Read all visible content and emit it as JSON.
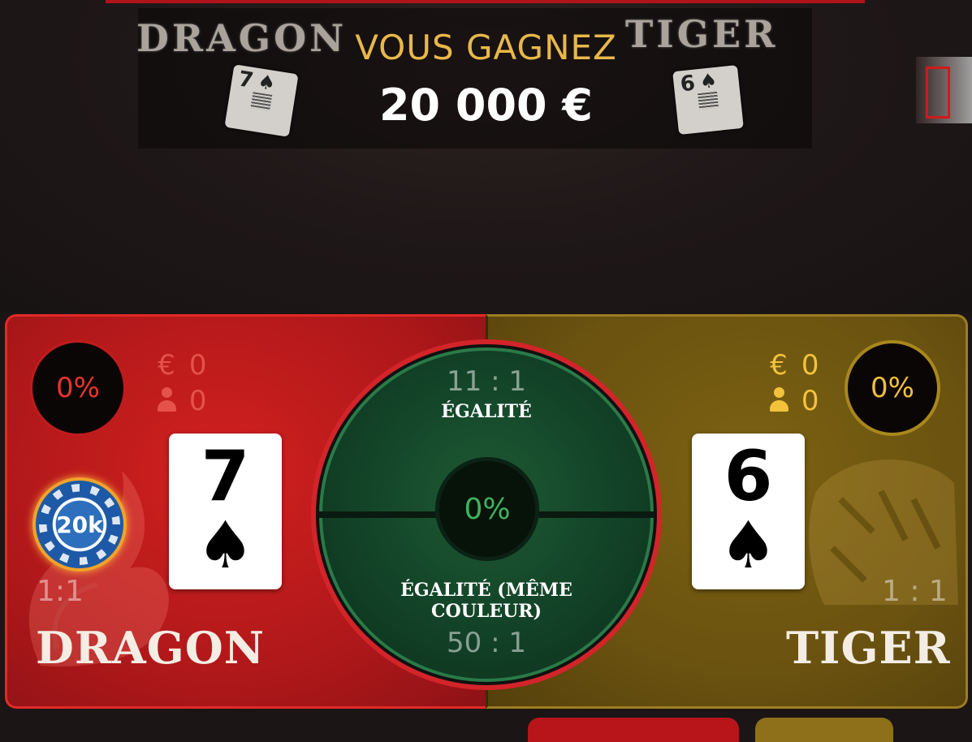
{
  "video": {
    "table_dragon_text": "DRAGON",
    "table_tiger_text": "TIGER",
    "dealt_cards": {
      "dragon": {
        "rank": "7",
        "suit": "♠"
      },
      "tiger": {
        "rank": "6",
        "suit": "♠"
      }
    }
  },
  "win_banner": {
    "label": "VOUS GAGNEZ",
    "amount": "20 000 €"
  },
  "dragon": {
    "percent": "0%",
    "money_symbol": "€",
    "money_amount": "0",
    "players_count": "0",
    "card_rank": "7",
    "card_suit": "♠",
    "chip_value": "20k",
    "odds": "1:1",
    "name": "DRAGON"
  },
  "tiger": {
    "percent": "0%",
    "money_symbol": "€",
    "money_amount": "0",
    "players_count": "0",
    "card_rank": "6",
    "card_suit": "♠",
    "odds": "1 : 1",
    "name": "TIGER"
  },
  "tie": {
    "odds": "11 : 1",
    "label": "ÉGALITÉ",
    "percent": "0%",
    "suited_label": "ÉGALITÉ (MÊME COULEUR)",
    "suited_odds": "50 : 1"
  },
  "colors": {
    "dragon_red": "#c21a1c",
    "tiger_gold": "#6a5210",
    "tie_green": "#124227",
    "win_gold": "#e7b84a"
  },
  "icons": {
    "money": "euro-icon",
    "players": "person-icon",
    "suit": "spade-icon"
  }
}
